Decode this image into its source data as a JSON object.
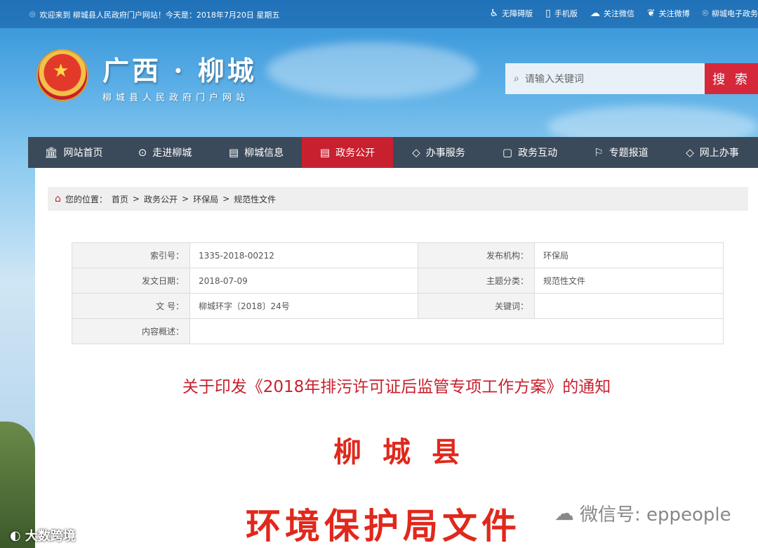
{
  "topbar": {
    "welcome": "欢迎来到 柳城县人民政府门户网站！今天是：2018年7月20日 星期五",
    "links": [
      {
        "label": "无障碍版",
        "icon": "accessibility-icon"
      },
      {
        "label": "手机版",
        "icon": "mobile-icon"
      },
      {
        "label": "关注微信",
        "icon": "wechat-icon"
      },
      {
        "label": "关注微博",
        "icon": "weibo-icon"
      },
      {
        "label": "柳城电子政务",
        "icon": "location-icon"
      }
    ]
  },
  "header": {
    "title": "广西 · 柳城",
    "subtitle": "柳城县人民政府门户网站",
    "search_placeholder": "请输入关键词",
    "search_button": "搜 索"
  },
  "nav": [
    {
      "label": "网站首页",
      "icon": "home-building-icon",
      "active": false
    },
    {
      "label": "走进柳城",
      "icon": "map-pin-icon",
      "active": false
    },
    {
      "label": "柳城信息",
      "icon": "document-icon",
      "active": false
    },
    {
      "label": "政务公开",
      "icon": "list-document-icon",
      "active": true
    },
    {
      "label": "办事服务",
      "icon": "tag-icon",
      "active": false
    },
    {
      "label": "政务互动",
      "icon": "chat-icon",
      "active": false
    },
    {
      "label": "专题报道",
      "icon": "flag-icon",
      "active": false
    },
    {
      "label": "网上办事",
      "icon": "tag-icon",
      "active": false
    }
  ],
  "breadcrumb": {
    "prefix": "您的位置：",
    "items": [
      "首页",
      "政务公开",
      "环保局",
      "规范性文件"
    ]
  },
  "meta": {
    "index_label": "索引号：",
    "index_value": "1335-2018-00212",
    "publisher_label": "发布机构：",
    "publisher_value": "环保局",
    "date_label": "发文日期：",
    "date_value": "2018-07-09",
    "topic_label": "主题分类：",
    "topic_value": "规范性文件",
    "docno_label": "文 号：",
    "docno_value": "柳城环字〔2018〕24号",
    "keyword_label": "关键词：",
    "keyword_value": "",
    "summary_label": "内容概述：",
    "summary_value": ""
  },
  "document": {
    "title": "关于印发《2018年排污许可证后监管专项工作方案》的通知",
    "org_line1": "柳城县",
    "org_line2": "环境保护局文件"
  },
  "watermarks": {
    "wechat": "微信号: eppeople",
    "corner": "大数跨境"
  },
  "colors": {
    "accent_red": "#c8202f",
    "nav_bg": "#3b4a5a",
    "doc_red": "#e0281c"
  }
}
